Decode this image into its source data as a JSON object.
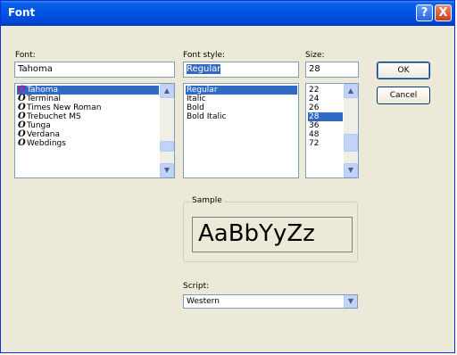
{
  "window": {
    "title": "Font",
    "help_glyph": "?",
    "close_glyph": "X"
  },
  "font": {
    "label": "Font:",
    "value": "Tahoma",
    "items": [
      {
        "name": "Tahoma",
        "selected": true
      },
      {
        "name": "Terminal",
        "selected": false
      },
      {
        "name": "Times New Roman",
        "selected": false
      },
      {
        "name": "Trebuchet MS",
        "selected": false
      },
      {
        "name": "Tunga",
        "selected": false
      },
      {
        "name": "Verdana",
        "selected": false
      },
      {
        "name": "Webdings",
        "selected": false
      }
    ]
  },
  "style": {
    "label": "Font style:",
    "value": "Regular",
    "items": [
      {
        "name": "Regular",
        "selected": true
      },
      {
        "name": "Italic",
        "selected": false
      },
      {
        "name": "Bold",
        "selected": false
      },
      {
        "name": "Bold Italic",
        "selected": false
      }
    ]
  },
  "size": {
    "label": "Size:",
    "value": "28",
    "items": [
      {
        "name": "22",
        "selected": false
      },
      {
        "name": "24",
        "selected": false
      },
      {
        "name": "26",
        "selected": false
      },
      {
        "name": "28",
        "selected": true
      },
      {
        "name": "36",
        "selected": false
      },
      {
        "name": "48",
        "selected": false
      },
      {
        "name": "72",
        "selected": false
      }
    ]
  },
  "buttons": {
    "ok": "OK",
    "cancel": "Cancel"
  },
  "sample": {
    "label": "Sample",
    "text": "AaBbYyZz"
  },
  "script": {
    "label": "Script:",
    "value": "Western"
  },
  "glyphs": {
    "font_type_icon": "O",
    "scroll_up": "▲",
    "scroll_down": "▼"
  }
}
